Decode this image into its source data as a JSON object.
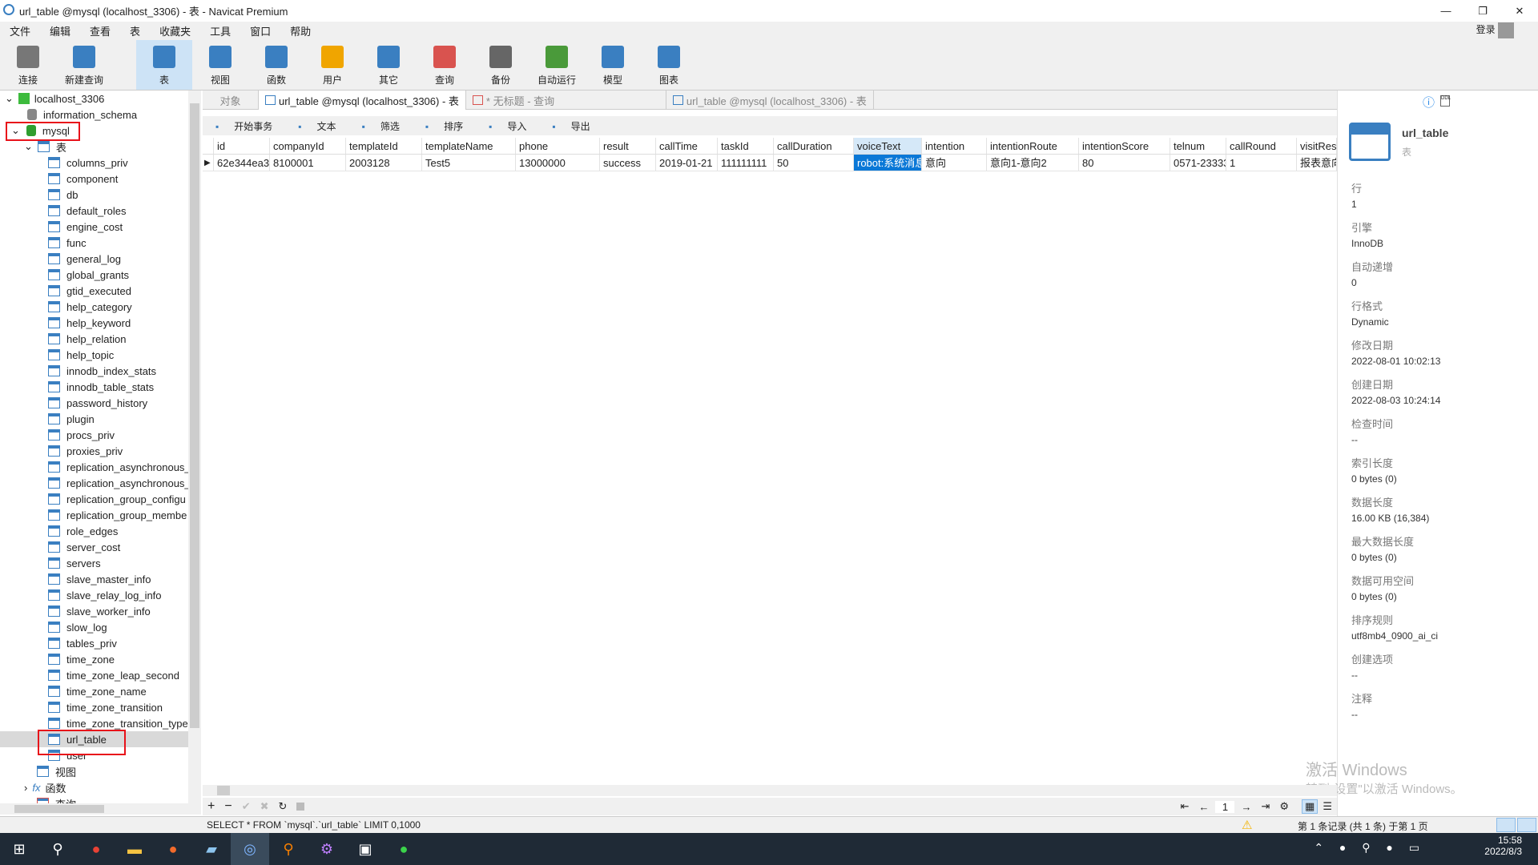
{
  "window": {
    "title": "url_table @mysql (localhost_3306) - 表 - Navicat Premium",
    "login": "登录"
  },
  "menu": [
    "文件",
    "编辑",
    "查看",
    "表",
    "收藏夹",
    "工具",
    "窗口",
    "帮助"
  ],
  "toolbar": [
    {
      "label": "连接",
      "icon": "connect-icon",
      "color": "#777"
    },
    {
      "label": "新建查询",
      "icon": "new-query-icon",
      "color": "#3a7fc1"
    },
    {
      "label": "表",
      "icon": "table-icon",
      "color": "#3a7fc1",
      "active": true
    },
    {
      "label": "视图",
      "icon": "view-icon",
      "color": "#3a7fc1"
    },
    {
      "label": "函数",
      "icon": "function-icon",
      "color": "#3a7fc1"
    },
    {
      "label": "用户",
      "icon": "user-icon",
      "color": "#f0a500"
    },
    {
      "label": "其它",
      "icon": "tools-icon",
      "color": "#3a7fc1"
    },
    {
      "label": "查询",
      "icon": "query-icon",
      "color": "#d9534f"
    },
    {
      "label": "备份",
      "icon": "backup-icon",
      "color": "#666"
    },
    {
      "label": "自动运行",
      "icon": "schedule-icon",
      "color": "#4a9a3a"
    },
    {
      "label": "模型",
      "icon": "model-icon",
      "color": "#3a7fc1"
    },
    {
      "label": "图表",
      "icon": "chart-icon",
      "color": "#3a7fc1"
    }
  ],
  "tree": {
    "connection": "localhost_3306",
    "schemas": [
      "information_schema",
      "mysql"
    ],
    "tables_label": "表",
    "tables": [
      "columns_priv",
      "component",
      "db",
      "default_roles",
      "engine_cost",
      "func",
      "general_log",
      "global_grants",
      "gtid_executed",
      "help_category",
      "help_keyword",
      "help_relation",
      "help_topic",
      "innodb_index_stats",
      "innodb_table_stats",
      "password_history",
      "plugin",
      "procs_priv",
      "proxies_priv",
      "replication_asynchronous_",
      "replication_asynchronous_",
      "replication_group_configu",
      "replication_group_membe",
      "role_edges",
      "server_cost",
      "servers",
      "slave_master_info",
      "slave_relay_log_info",
      "slave_worker_info",
      "slow_log",
      "tables_priv",
      "time_zone",
      "time_zone_leap_second",
      "time_zone_name",
      "time_zone_transition",
      "time_zone_transition_type",
      "url_table",
      "user"
    ],
    "views_label": "视图",
    "functions_label": "函数",
    "queries_label": "查询"
  },
  "tabs": [
    {
      "label": "对象"
    },
    {
      "label": "url_table @mysql (localhost_3306) - 表"
    },
    {
      "label": "* 无标题 - 查询"
    },
    {
      "label": "url_table @mysql (localhost_3306) - 表"
    }
  ],
  "grid_tools": [
    "开始事务",
    "文本",
    "筛选",
    "排序",
    "导入",
    "导出"
  ],
  "grid": {
    "columns": [
      "id",
      "companyId",
      "templateId",
      "templateName",
      "phone",
      "result",
      "callTime",
      "taskId",
      "callDuration",
      "voiceText",
      "intention",
      "intentionRoute",
      "intentionScore",
      "telnum",
      "callRound",
      "visitResu"
    ],
    "rows": [
      [
        "62e344ea3(",
        "8100001",
        "2003128",
        "Test5",
        "13000000",
        "success",
        "2019-01-21",
        "111111111",
        "50",
        "robot:系统消息",
        "意向",
        "意向1-意向2",
        "80",
        "0571-23333",
        "1",
        "报表意向"
      ]
    ]
  },
  "info": {
    "name": "url_table",
    "type": "表",
    "props": [
      [
        "行",
        "1"
      ],
      [
        "引擎",
        "InnoDB"
      ],
      [
        "自动递增",
        "0"
      ],
      [
        "行格式",
        "Dynamic"
      ],
      [
        "修改日期",
        "2022-08-01 10:02:13"
      ],
      [
        "创建日期",
        "2022-08-03 10:24:14"
      ],
      [
        "检查时间",
        "--"
      ],
      [
        "索引长度",
        "0 bytes (0)"
      ],
      [
        "数据长度",
        "16.00 KB (16,384)"
      ],
      [
        "最大数据长度",
        "0 bytes (0)"
      ],
      [
        "数据可用空间",
        "0 bytes (0)"
      ],
      [
        "排序规则",
        "utf8mb4_0900_ai_ci"
      ],
      [
        "创建选项",
        "--"
      ],
      [
        "注释",
        "--"
      ]
    ]
  },
  "nav": {
    "page": "1"
  },
  "status": {
    "sql": "SELECT * FROM `mysql`.`url_table` LIMIT 0,1000",
    "records": "第 1 条记录 (共 1 条) 于第 1 页"
  },
  "watermark": {
    "line1": "激活 Windows",
    "line2": "转到\"设置\"以激活 Windows。"
  },
  "clock": {
    "time": "15:58",
    "date": "2022/8/3"
  }
}
